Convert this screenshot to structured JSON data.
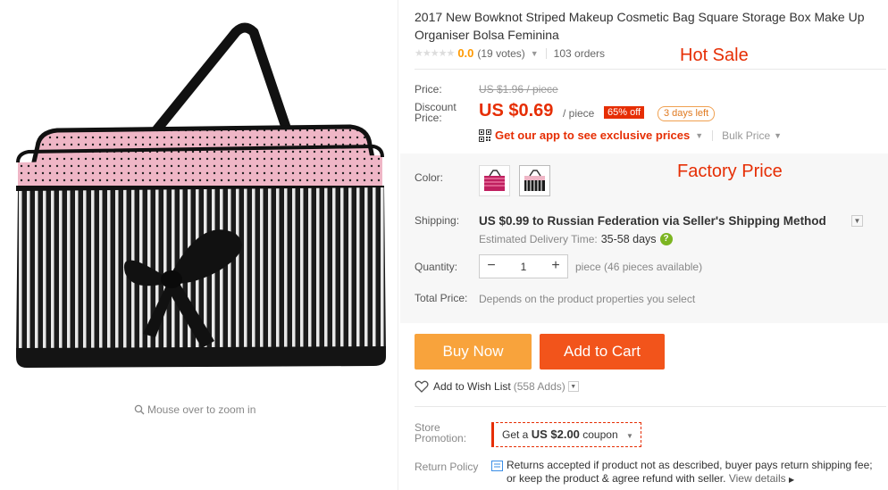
{
  "product": {
    "title": "2017 New Bowknot Striped Makeup Cosmetic Bag Square Storage Box Make Up Organiser Bolsa Feminina",
    "zoom_hint": "Mouse over to zoom in",
    "image_icon": "makeup-bag-image"
  },
  "rating": {
    "stars": "★★★★★",
    "value": "0.0",
    "votes": "(19 votes)",
    "orders": "103 orders"
  },
  "promo": {
    "hot_sale": "Hot Sale",
    "factory_price": "Factory Price"
  },
  "price": {
    "label": "Price:",
    "original": "US $1.96 / piece",
    "discount_label_1": "Discount",
    "discount_label_2": "Price:",
    "discount": "US $0.69",
    "unit": "/ piece",
    "off": "65% off",
    "days_left": "3 days left",
    "app_promo": "Get our app to see exclusive prices",
    "bulk": "Bulk Price"
  },
  "color": {
    "label": "Color:",
    "options": [
      "pink-striped",
      "black-striped"
    ]
  },
  "shipping": {
    "label": "Shipping:",
    "method": "US $0.99 to Russian Federation via Seller's Shipping Method",
    "eta_label": "Estimated Delivery Time:",
    "eta_value": "35-58 days",
    "help": "?"
  },
  "quantity": {
    "label": "Quantity:",
    "value": "1",
    "minus": "−",
    "plus": "+",
    "available": "piece (46 pieces available)"
  },
  "total": {
    "label": "Total Price:",
    "text": "Depends on the product properties you select"
  },
  "actions": {
    "buy_now": "Buy Now",
    "add_to_cart": "Add to Cart",
    "wish_list": "Add to Wish List",
    "wish_count": "(558 Adds)"
  },
  "store_promotion": {
    "label_1": "Store",
    "label_2": "Promotion:",
    "coupon_pre": "Get a",
    "coupon_amount": "US $2.00",
    "coupon_post": "coupon"
  },
  "return_policy": {
    "label": "Return Policy",
    "text": "Returns accepted if product not as described, buyer pays return shipping fee; or keep the product & agree refund with seller.",
    "view_details": "View details"
  },
  "colors": {
    "accent": "#e62e04",
    "buy_now": "#f8a33c",
    "add_to_cart": "#f2541b",
    "rating": "#ff9900"
  }
}
